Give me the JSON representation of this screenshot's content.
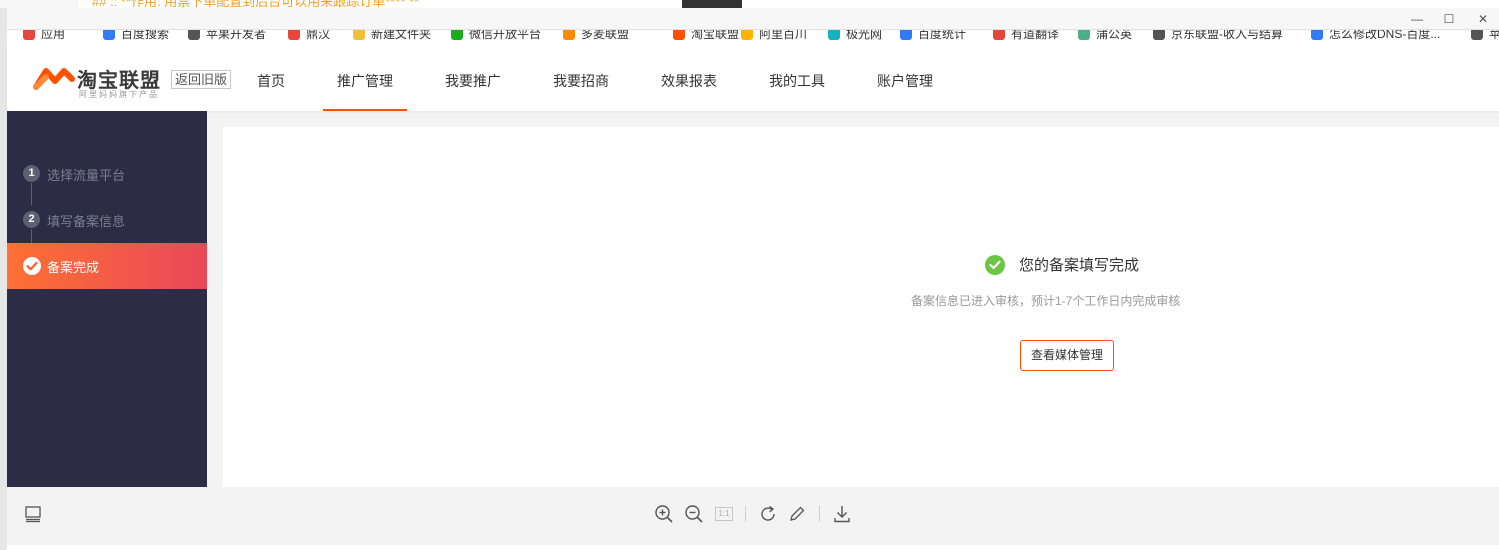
{
  "bg_peek_text": "## :: **作用: 用票下单配置到后台可以用来跟踪订单**** **",
  "window": {
    "minimize": "—",
    "maximize": "☐",
    "close": "✕"
  },
  "bookmarks": [
    {
      "label": "应用",
      "color": "#e8453c"
    },
    {
      "label": "百度搜索",
      "color": "#2f7cf6"
    },
    {
      "label": "苹果开发者",
      "color": "#555555"
    },
    {
      "label": "鼎汉",
      "color": "#e8453c"
    },
    {
      "label": "新建文件夹",
      "color": "#f2c037"
    },
    {
      "label": "微信开放平台",
      "color": "#1aad19"
    },
    {
      "label": "多麦联盟",
      "color": "#ff8a00"
    },
    {
      "label": "淘宝联盟",
      "color": "#ff5000"
    },
    {
      "label": "阿里百川",
      "color": "#ffb400"
    },
    {
      "label": "极光网",
      "color": "#15b3c1"
    },
    {
      "label": "百度统计",
      "color": "#2f7cf6"
    },
    {
      "label": "有道翻译",
      "color": "#e8453c"
    },
    {
      "label": "蒲公英",
      "color": "#4caf8a"
    },
    {
      "label": "京东联盟-收入与结算",
      "color": "#555555"
    },
    {
      "label": "怎么修改DNS-百度...",
      "color": "#2f7cf6"
    },
    {
      "label": "苹果",
      "color": "#555555"
    }
  ],
  "header": {
    "logo_title": "淘宝联盟",
    "logo_sub": "阿里妈妈旗下产品",
    "old_version": "返回旧版",
    "nav": [
      {
        "label": "首页",
        "active": false
      },
      {
        "label": "推广管理",
        "active": true
      },
      {
        "label": "我要推广",
        "active": false
      },
      {
        "label": "我要招商",
        "active": false
      },
      {
        "label": "效果报表",
        "active": false
      },
      {
        "label": "我的工具",
        "active": false
      },
      {
        "label": "账户管理",
        "active": false
      }
    ]
  },
  "steps": [
    {
      "num": "1",
      "label": "选择流量平台",
      "done": false
    },
    {
      "num": "2",
      "label": "填写备案信息",
      "done": false
    },
    {
      "num": "✓",
      "label": "备案完成",
      "done": true
    }
  ],
  "result": {
    "title": "您的备案填写完成",
    "desc": "备案信息已进入审核，预计1-7个工作日内完成审核",
    "button": "查看媒体管理"
  },
  "toolbar": {
    "page_indicator": "1:1",
    "icons": [
      "thumbnail-icon",
      "zoom-in-icon",
      "zoom-out-icon",
      "actual-size-icon",
      "rotate-icon",
      "edit-icon",
      "download-icon"
    ]
  },
  "colors": {
    "accent": "#ff5000",
    "sidebar_bg": "#2c2c46",
    "success": "#6cc644"
  }
}
